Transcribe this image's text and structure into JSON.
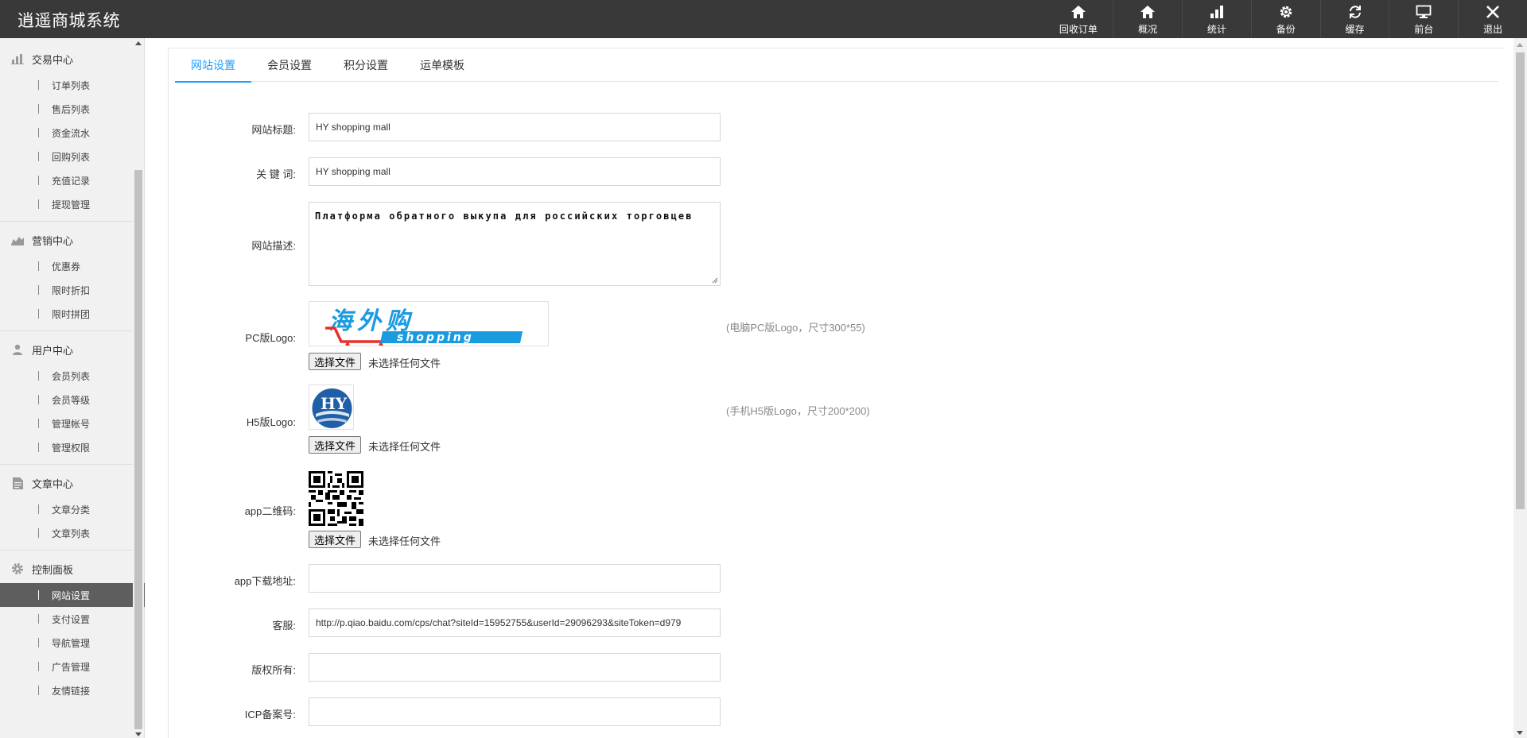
{
  "app": {
    "title": "逍遥商城系统"
  },
  "topnav": [
    {
      "label": "回收订单",
      "icon": "home-icon"
    },
    {
      "label": "概况",
      "icon": "home-icon"
    },
    {
      "label": "统计",
      "icon": "bar-chart-icon"
    },
    {
      "label": "备份",
      "icon": "gear-icon"
    },
    {
      "label": "缓存",
      "icon": "refresh-icon"
    },
    {
      "label": "前台",
      "icon": "monitor-icon"
    },
    {
      "label": "退出",
      "icon": "close-icon"
    }
  ],
  "sidebar": {
    "groups": [
      {
        "title": "交易中心",
        "icon": "bar-chart-icon",
        "items": [
          "订单列表",
          "售后列表",
          "资金流水",
          "回购列表",
          "充值记录",
          "提现管理"
        ]
      },
      {
        "title": "营销中心",
        "icon": "area-chart-icon",
        "items": [
          "优惠券",
          "限时折扣",
          "限时拼团"
        ]
      },
      {
        "title": "用户中心",
        "icon": "user-icon",
        "items": [
          "会员列表",
          "会员等级",
          "管理帐号",
          "管理权限"
        ]
      },
      {
        "title": "文章中心",
        "icon": "document-icon",
        "items": [
          "文章分类",
          "文章列表"
        ]
      },
      {
        "title": "控制面板",
        "icon": "gear-icon",
        "items": [
          "网站设置",
          "支付设置",
          "导航管理",
          "广告管理",
          "友情链接"
        ]
      }
    ],
    "active_item": "网站设置"
  },
  "tabs": [
    "网站设置",
    "会员设置",
    "积分设置",
    "运单模板"
  ],
  "active_tab": "网站设置",
  "form": {
    "site_title": {
      "label": "网站标题:",
      "value": "HY shopping mall"
    },
    "keywords": {
      "label": "关 键 词:",
      "value": "HY shopping mall"
    },
    "description": {
      "label": "网站描述:",
      "value": "Платформа обратного выкупа для российских торговцев"
    },
    "pc_logo": {
      "label": "PC版Logo:",
      "hint": "(电脑PC版Logo，尺寸300*55)",
      "logo_text": "海外购",
      "logo_sub": "shopping"
    },
    "h5_logo": {
      "label": "H5版Logo:",
      "hint": "(手机H5版Logo，尺寸200*200)",
      "logo_text": "HY"
    },
    "app_qr": {
      "label": "app二维码:"
    },
    "file_button": "选择文件",
    "file_none": "未选择任何文件",
    "app_url": {
      "label": "app下载地址:",
      "value": ""
    },
    "customer_service": {
      "label": "客服:",
      "value": "http://p.qiao.baidu.com/cps/chat?siteId=15952755&userId=29096293&siteToken=d979"
    },
    "copyright": {
      "label": "版权所有:",
      "value": ""
    },
    "icp": {
      "label": "ICP备案号:",
      "value": ""
    }
  },
  "colors": {
    "topbar": "#393939",
    "accent": "#1e9fff",
    "sidebar_active": "#5e5e5e",
    "logo_blue": "#1a9be0",
    "logo_cart": "#e8302a"
  }
}
